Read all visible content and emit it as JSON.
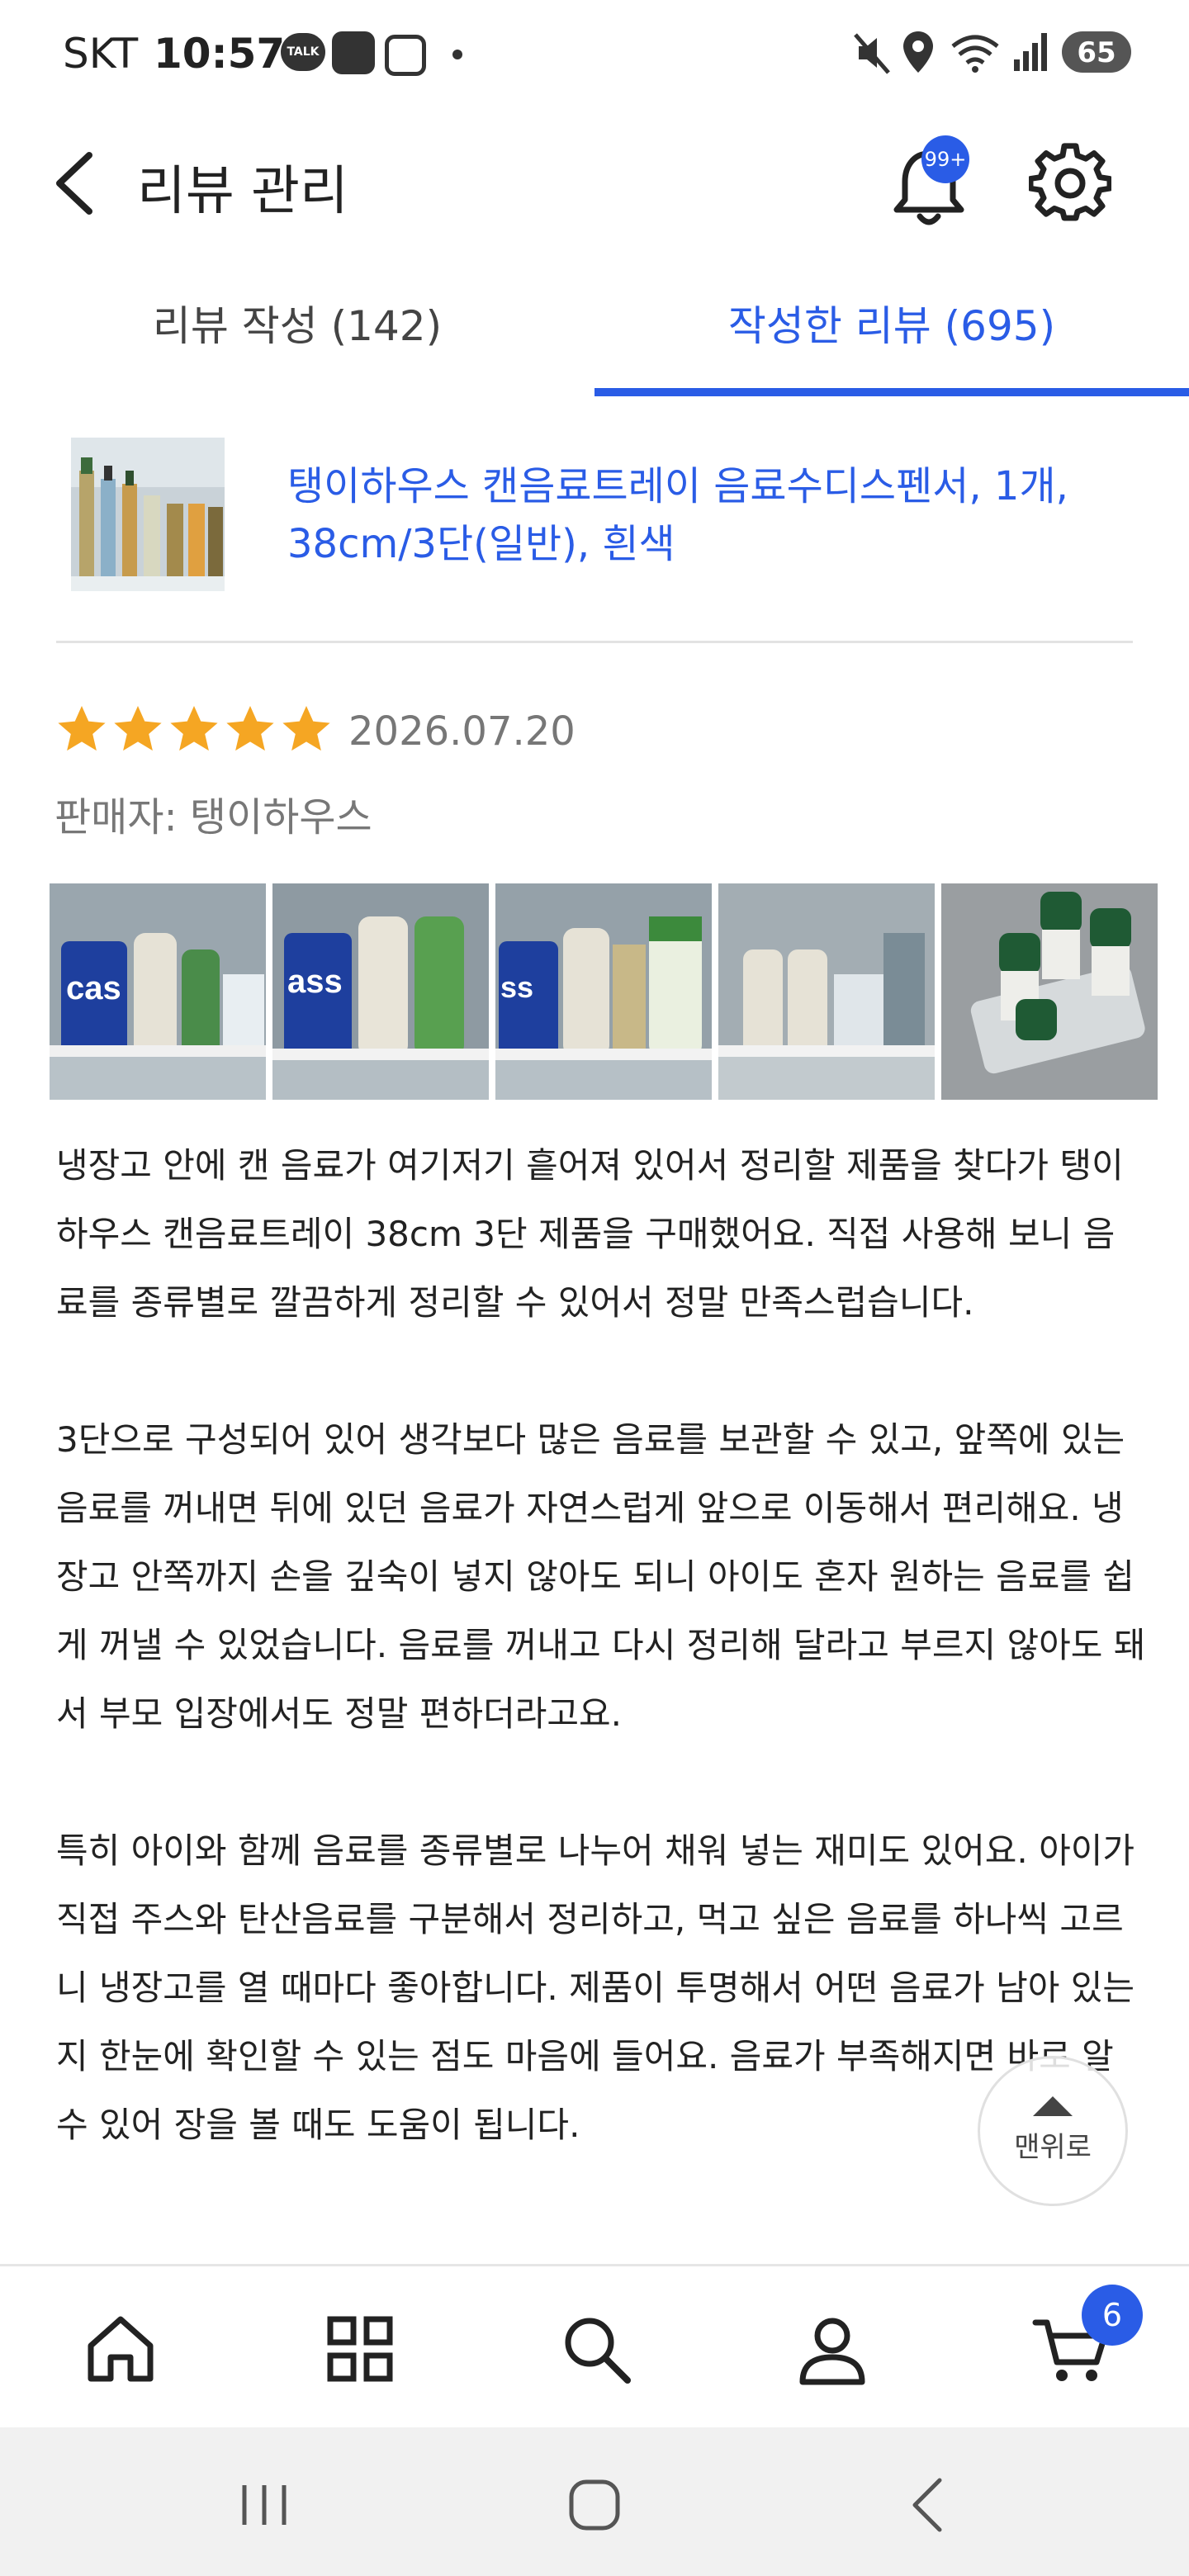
{
  "status_bar": {
    "carrier": "SKT",
    "time": "10:57",
    "talk_icon_label": "TALK",
    "battery": "65",
    "icons": [
      "talk-icon",
      "samsung-app-icon",
      "screenshot-icon",
      "dot-icon",
      "mute-icon",
      "location-icon",
      "wifi-icon",
      "signal-icon",
      "battery-icon"
    ]
  },
  "header": {
    "title": "리뷰 관리",
    "notification_badge": "99+"
  },
  "tabs": [
    {
      "label": "리뷰 작성 (142)",
      "active": false
    },
    {
      "label": "작성한 리뷰 (695)",
      "active": true
    }
  ],
  "product": {
    "title": "탱이하우스 캔음료트레이 음료수디스펜서, 1개, 38cm/3단(일반), 흰색"
  },
  "review": {
    "rating": 5,
    "date": "2026.07.20",
    "seller": "판매자: 탱이하우스",
    "photo_count": 5,
    "paragraphs": [
      "냉장고 안에 캔 음료가 여기저기 흩어져 있어서 정리할 제품을 찾다가 탱이하우스 캔음료트레이 38cm 3단 제품을 구매했어요. 직접 사용해 보니 음료를 종류별로 깔끔하게 정리할 수 있어서 정말 만족스럽습니다.",
      "3단으로 구성되어 있어 생각보다 많은 음료를 보관할 수 있고, 앞쪽에 있는 음료를 꺼내면 뒤에 있던 음료가 자연스럽게 앞으로 이동해서 편리해요. 냉장고 안쪽까지 손을 깊숙이 넣지 않아도 되니 아이도 혼자 원하는 음료를 쉽게 꺼낼 수 있었습니다. 음료를 꺼내고 다시 정리해 달라고 부르지 않아도 돼서 부모 입장에서도 정말 편하더라고요.",
      "특히 아이와 함께 음료를 종류별로 나누어 채워 넣는 재미도 있어요. 아이가 직접 주스와 탄산음료를 구분해서 정리하고, 먹고 싶은 음료를 하나씩 고르니 냉장고를 열 때마다 좋아합니다. 제품이 투명해서 어떤 음료가 남아 있는지 한눈에 확인할 수 있는 점도 마음에 들어요. 음료가 부족해지면 바로 알 수 있어 장을 볼 때도 도움이 됩니다."
    ]
  },
  "scroll_top": {
    "label": "맨위로"
  },
  "bottom_nav": {
    "items": [
      "home-icon",
      "grid-icon",
      "search-icon",
      "person-icon",
      "cart-icon"
    ],
    "cart_badge": "6"
  },
  "colors": {
    "accent": "#2a5ce6",
    "star": "#f5a623",
    "text_gray": "#777777"
  }
}
